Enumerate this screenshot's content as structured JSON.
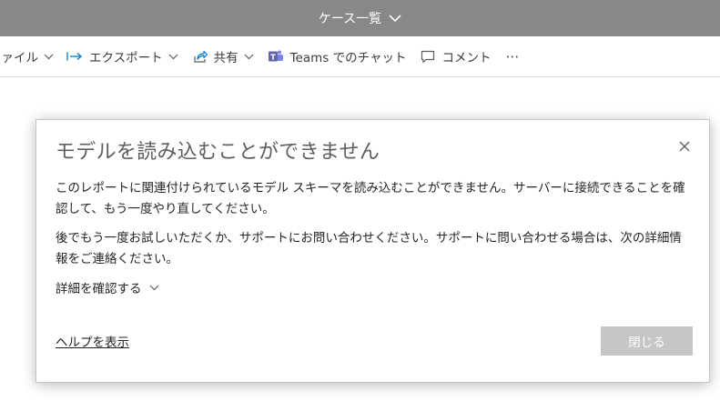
{
  "header": {
    "title": "ケース一覧"
  },
  "toolbar": {
    "file_label": "ファイル",
    "export_label": "エクスポート",
    "share_label": "共有",
    "teams_label": "Teams でのチャット",
    "comment_label": "コメント",
    "more_label": "⋯"
  },
  "dialog": {
    "title": "モデルを読み込むことができません",
    "message1": "このレポートに関連付けられているモデル スキーマを読み込むことができません。サーバーに接続できることを確認して、もう一度やり直してください。",
    "message2": "後でもう一度お試しいただくか、サポートにお問い合わせください。サポートに問い合わせる場合は、次の詳細情報をご連絡ください。",
    "details_label": "詳細を確認する",
    "help_link": "ヘルプを表示",
    "close_button": "閉じる"
  },
  "colors": {
    "titlebar_bg": "#8a8886",
    "dialog_button_disabled": "#c8c6c4",
    "teams_icon": "#6264a7",
    "export_icon": "#0078d4"
  },
  "icons": [
    "chevron-down-icon",
    "export-icon",
    "share-icon",
    "teams-icon",
    "comment-icon",
    "close-icon"
  ]
}
